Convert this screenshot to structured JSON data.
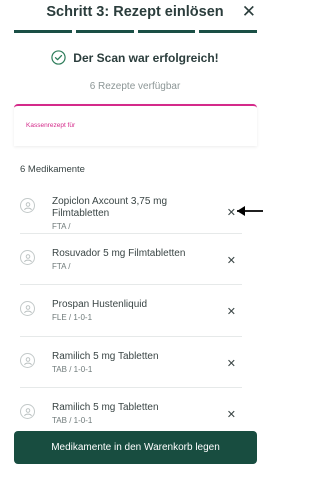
{
  "header": {
    "title": "Schritt 3: Rezept einlösen",
    "close_icon": "close-icon"
  },
  "progress": {
    "steps_total": 4,
    "steps_completed": 4
  },
  "status": {
    "success_message": "Der Scan war erfolgreich!",
    "available_text": "6 Rezepte verfügbar"
  },
  "receipt": {
    "label": "Kassenrezept für"
  },
  "medications": {
    "title": "6 Medikamente",
    "items": [
      {
        "name": "Zopiclon Axcount 3,75 mg Filmtabletten",
        "detail": "FTA /"
      },
      {
        "name": "Rosuvador 5 mg Filmtabletten",
        "detail": "FTA /"
      },
      {
        "name": "Prospan Hustenliquid",
        "detail": "FLE / 1-0-1"
      },
      {
        "name": "Ramilich 5 mg Tabletten",
        "detail": "TAB / 1-0-1"
      },
      {
        "name": "Ramilich 5 mg Tabletten",
        "detail": "TAB / 1-0-1"
      }
    ]
  },
  "cta": {
    "label": "Medikamente in den Warenkorb legen"
  },
  "colors": {
    "primary": "#184d40",
    "accent": "#d42a8a",
    "success": "#2e7d5b"
  }
}
